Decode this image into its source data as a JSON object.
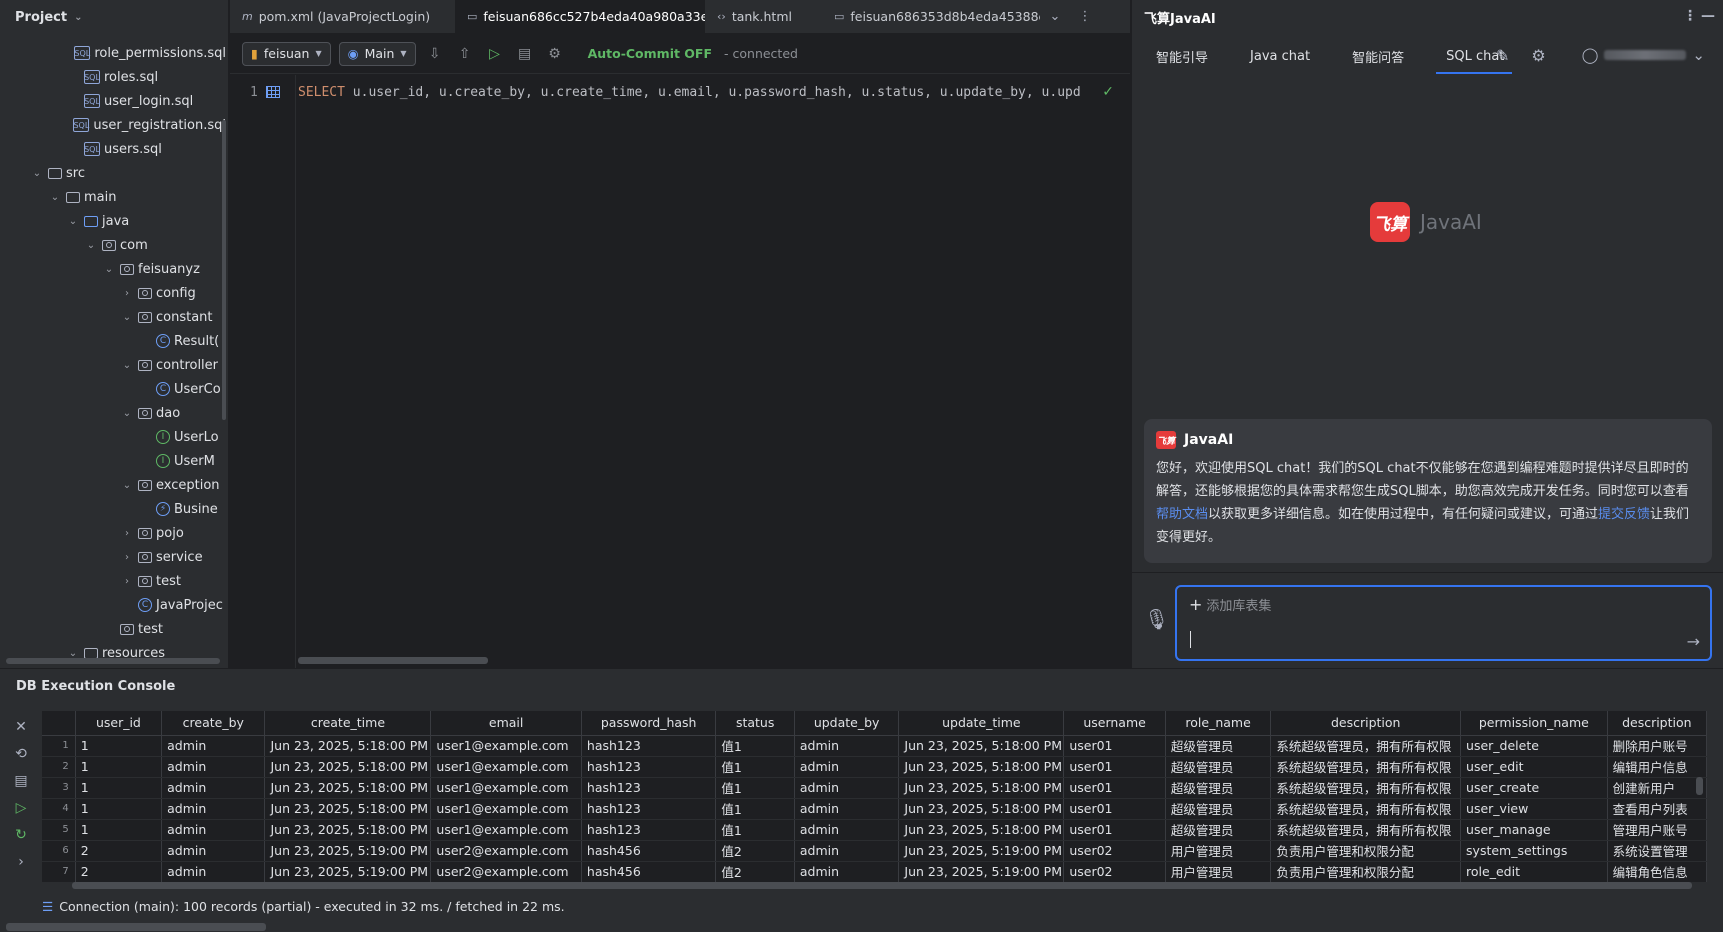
{
  "project": {
    "title": "Project",
    "tree": [
      {
        "label": "role_permissions.sql",
        "icon": "sql-file-icon",
        "depth": 3,
        "arrow": ""
      },
      {
        "label": "roles.sql",
        "icon": "sql-file-icon",
        "depth": 3,
        "arrow": ""
      },
      {
        "label": "user_login.sql",
        "icon": "sql-file-icon",
        "depth": 3,
        "arrow": ""
      },
      {
        "label": "user_registration.sql",
        "icon": "sql-file-icon",
        "depth": 3,
        "arrow": ""
      },
      {
        "label": "users.sql",
        "icon": "sql-file-icon",
        "depth": 3,
        "arrow": ""
      },
      {
        "label": "src",
        "icon": "folder-icon",
        "depth": 1,
        "arrow": "expanded"
      },
      {
        "label": "main",
        "icon": "folder-icon",
        "depth": 2,
        "arrow": "expanded"
      },
      {
        "label": "java",
        "icon": "source-folder-icon",
        "depth": 3,
        "arrow": "expanded"
      },
      {
        "label": "com",
        "icon": "package-icon",
        "depth": 4,
        "arrow": "expanded"
      },
      {
        "label": "feisuanyz",
        "icon": "package-icon",
        "depth": 5,
        "arrow": "expanded"
      },
      {
        "label": "config",
        "icon": "package-icon",
        "depth": 6,
        "arrow": "collapsed"
      },
      {
        "label": "constant",
        "icon": "package-icon",
        "depth": 6,
        "arrow": "expanded"
      },
      {
        "label": "Result(",
        "icon": "class-icon",
        "depth": 7,
        "arrow": ""
      },
      {
        "label": "controller",
        "icon": "package-icon",
        "depth": 6,
        "arrow": "expanded"
      },
      {
        "label": "UserCo",
        "icon": "class-icon",
        "depth": 7,
        "arrow": ""
      },
      {
        "label": "dao",
        "icon": "package-icon",
        "depth": 6,
        "arrow": "expanded"
      },
      {
        "label": "UserLo",
        "icon": "interface-icon",
        "depth": 7,
        "arrow": ""
      },
      {
        "label": "UserM",
        "icon": "interface-icon",
        "depth": 7,
        "arrow": ""
      },
      {
        "label": "exception",
        "icon": "package-icon",
        "depth": 6,
        "arrow": "expanded"
      },
      {
        "label": "Busine",
        "icon": "exception-class-icon",
        "depth": 7,
        "arrow": ""
      },
      {
        "label": "pojo",
        "icon": "package-icon",
        "depth": 6,
        "arrow": "collapsed"
      },
      {
        "label": "service",
        "icon": "package-icon",
        "depth": 6,
        "arrow": "collapsed"
      },
      {
        "label": "test",
        "icon": "package-icon",
        "depth": 6,
        "arrow": "collapsed"
      },
      {
        "label": "JavaProjec",
        "icon": "spring-class-icon",
        "depth": 6,
        "arrow": ""
      },
      {
        "label": "test",
        "icon": "package-icon",
        "depth": 5,
        "arrow": ""
      },
      {
        "label": "resources",
        "icon": "resources-folder-icon",
        "depth": 3,
        "arrow": "expanded"
      }
    ]
  },
  "editor": {
    "tabs": [
      {
        "label": "pom.xml (JavaProjectLogin)",
        "icon": "maven-icon",
        "active": false
      },
      {
        "label": "feisuan686cc527b4eda40a980a33e2",
        "icon": "console-file-icon",
        "active": true
      },
      {
        "label": "tank.html",
        "icon": "html-icon",
        "active": false
      },
      {
        "label": "feisuan686353d8b4eda45388e",
        "icon": "console-file-icon",
        "active": false
      }
    ],
    "toolbar": {
      "datasource": "feisuan",
      "session": "Main",
      "autocommit": "Auto-Commit OFF",
      "connection_status": "- connected"
    },
    "line_number": "1",
    "code_line": "SELECT u.user_id, u.create_by, u.create_time, u.email, u.password_hash, u.status, u.update_by, u.upd"
  },
  "ai": {
    "title": "飞算JavaAI",
    "tabs": [
      "智能引导",
      "Java chat",
      "智能问答",
      "SQL chat"
    ],
    "active_tab": "SQL chat",
    "logo_mark": "飞算",
    "logo_text": "JavaAI",
    "message": {
      "sender": "JavaAI",
      "text_1": "您好，欢迎使用SQL chat！我们的SQL chat不仅能够在您遇到编程难题时提供详尽且即时的解答，还能够根据您的具体需求帮您生成SQL脚本，助您高效完成开发任务。同时您可以查看",
      "link_1": "帮助文档",
      "text_2": "以获取更多详细信息。如在使用过程中，有任何疑问或建议，可通过",
      "link_2": "提交反馈",
      "text_3": "让我们变得更好。"
    },
    "input": {
      "add_label": "添加库表集"
    }
  },
  "console": {
    "title": "DB Execution Console",
    "columns": [
      "user_id",
      "create_by",
      "create_time",
      "email",
      "password_hash",
      "status",
      "update_by",
      "update_time",
      "username",
      "role_name",
      "description",
      "permission_name",
      "description"
    ],
    "rows": [
      [
        "1",
        "admin",
        "Jun 23, 2025, 5:18:00 PM",
        "user1@example.com",
        "hash123",
        "值1",
        "admin",
        "Jun 23, 2025, 5:18:00 PM",
        "user01",
        "超级管理员",
        "系统超级管理员，拥有所有权限",
        "user_delete",
        "删除用户账号"
      ],
      [
        "1",
        "admin",
        "Jun 23, 2025, 5:18:00 PM",
        "user1@example.com",
        "hash123",
        "值1",
        "admin",
        "Jun 23, 2025, 5:18:00 PM",
        "user01",
        "超级管理员",
        "系统超级管理员，拥有所有权限",
        "user_edit",
        "编辑用户信息"
      ],
      [
        "1",
        "admin",
        "Jun 23, 2025, 5:18:00 PM",
        "user1@example.com",
        "hash123",
        "值1",
        "admin",
        "Jun 23, 2025, 5:18:00 PM",
        "user01",
        "超级管理员",
        "系统超级管理员，拥有所有权限",
        "user_create",
        "创建新用户"
      ],
      [
        "1",
        "admin",
        "Jun 23, 2025, 5:18:00 PM",
        "user1@example.com",
        "hash123",
        "值1",
        "admin",
        "Jun 23, 2025, 5:18:00 PM",
        "user01",
        "超级管理员",
        "系统超级管理员，拥有所有权限",
        "user_view",
        "查看用户列表"
      ],
      [
        "1",
        "admin",
        "Jun 23, 2025, 5:18:00 PM",
        "user1@example.com",
        "hash123",
        "值1",
        "admin",
        "Jun 23, 2025, 5:18:00 PM",
        "user01",
        "超级管理员",
        "系统超级管理员，拥有所有权限",
        "user_manage",
        "管理用户账号"
      ],
      [
        "2",
        "admin",
        "Jun 23, 2025, 5:19:00 PM",
        "user2@example.com",
        "hash456",
        "值2",
        "admin",
        "Jun 23, 2025, 5:19:00 PM",
        "user02",
        "用户管理员",
        "负责用户管理和权限分配",
        "system_settings",
        "系统设置管理"
      ],
      [
        "2",
        "admin",
        "Jun 23, 2025, 5:19:00 PM",
        "user2@example.com",
        "hash456",
        "值2",
        "admin",
        "Jun 23, 2025, 5:19:00 PM",
        "user02",
        "用户管理员",
        "负责用户管理和权限分配",
        "role_edit",
        "编辑角色信息"
      ]
    ],
    "status": "Connection (main): 100 records  (partial) - executed in 32 ms. / fetched in 22 ms."
  }
}
